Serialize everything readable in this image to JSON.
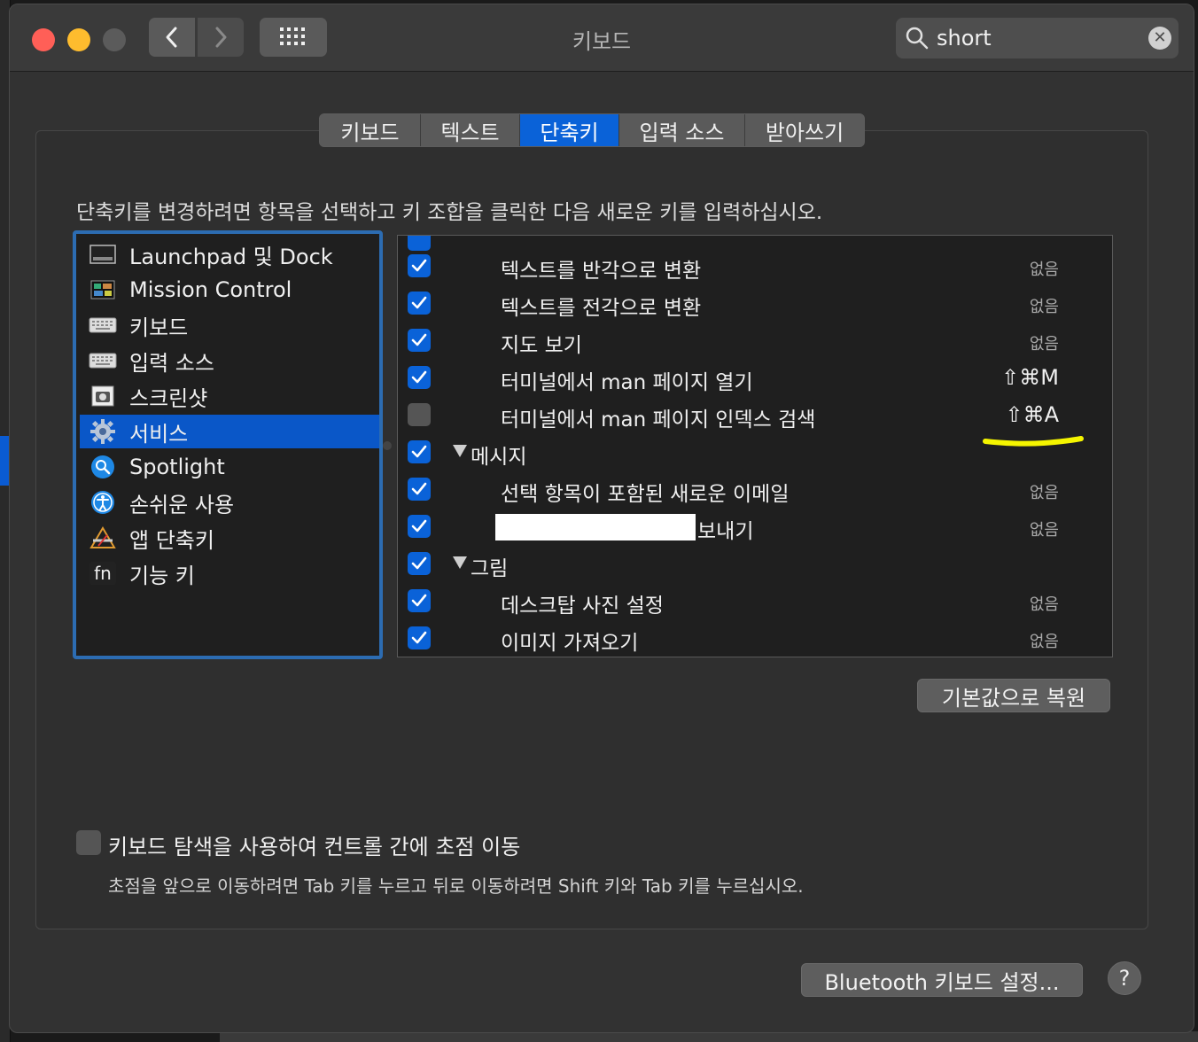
{
  "window": {
    "title": "키보드"
  },
  "search": {
    "value": "short"
  },
  "tabs": [
    {
      "label": "키보드",
      "active": false
    },
    {
      "label": "텍스트",
      "active": false
    },
    {
      "label": "단축키",
      "active": true
    },
    {
      "label": "입력 소스",
      "active": false
    },
    {
      "label": "받아쓰기",
      "active": false
    }
  ],
  "instruction": "단축키를 변경하려면 항목을 선택하고 키 조합을 클릭한 다음 새로운 키를 입력하십시오.",
  "sidebar": {
    "items": [
      {
        "label": "Launchpad 및 Dock",
        "icon": "launchpad-dock-icon",
        "selected": false
      },
      {
        "label": "Mission Control",
        "icon": "mission-control-icon",
        "selected": false
      },
      {
        "label": "키보드",
        "icon": "keyboard-icon",
        "selected": false
      },
      {
        "label": "입력 소스",
        "icon": "keyboard-icon",
        "selected": false
      },
      {
        "label": "스크린샷",
        "icon": "screenshot-icon",
        "selected": false
      },
      {
        "label": "서비스",
        "icon": "gear-icon",
        "selected": true
      },
      {
        "label": "Spotlight",
        "icon": "spotlight-icon",
        "selected": false
      },
      {
        "label": "손쉬운 사용",
        "icon": "accessibility-icon",
        "selected": false
      },
      {
        "label": "앱 단축키",
        "icon": "app-shortcuts-icon",
        "selected": false
      },
      {
        "label": "기능 키",
        "icon": "fn-key-icon",
        "fn_text": "fn",
        "selected": false
      }
    ]
  },
  "shortcuts": {
    "rows": [
      {
        "label": "텍스트를 반각으로 변환",
        "checked": true,
        "shortcut": "없음"
      },
      {
        "label": "텍스트를 전각으로 변환",
        "checked": true,
        "shortcut": "없음"
      },
      {
        "label": "지도 보기",
        "checked": true,
        "shortcut": "없음"
      },
      {
        "label": "터미널에서 man 페이지 열기",
        "checked": true,
        "shortcut": "⇧⌘M"
      },
      {
        "label": "터미널에서 man 페이지 인덱스 검색",
        "checked": false,
        "shortcut": "⇧⌘A"
      },
      {
        "label": "메시지",
        "checked": true,
        "group": true
      },
      {
        "label": "선택 항목이 포함된 새로운 이메일",
        "checked": true,
        "shortcut": "없음"
      },
      {
        "label": "보내기",
        "checked": true,
        "shortcut": "없음",
        "redacted_prefix": true
      },
      {
        "label": "그림",
        "checked": true,
        "group": true
      },
      {
        "label": "데스크탑 사진 설정",
        "checked": true,
        "shortcut": "없음"
      },
      {
        "label": "이미지 가져오기",
        "checked": true,
        "shortcut": "없음"
      }
    ]
  },
  "buttons": {
    "restore_defaults": "기본값으로 복원",
    "bluetooth_setup": "Bluetooth 키보드 설정...",
    "help": "?"
  },
  "keyboard_navigation": {
    "label": "키보드 탐색을 사용하여 컨트롤 간에 초점 이동",
    "checked": false,
    "description": "초점을 앞으로 이동하려면 Tab 키를 누르고 뒤로 이동하려면 Shift 키와 Tab 키를 누르십시오."
  },
  "colors": {
    "accent": "#0a62d8",
    "highlight_annotation": "#f5f500"
  }
}
